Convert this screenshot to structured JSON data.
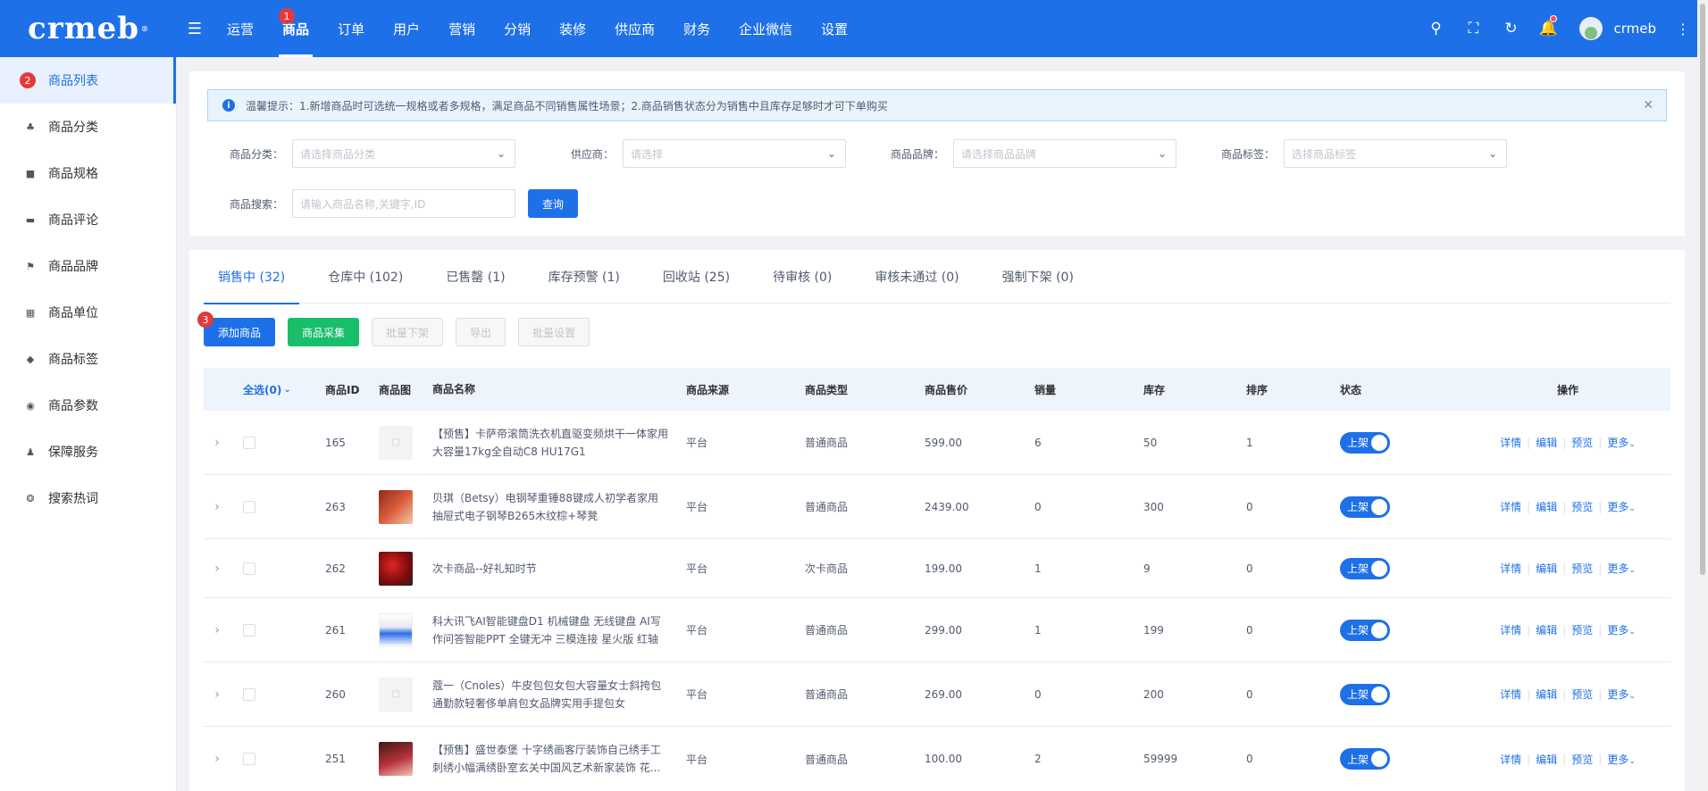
{
  "header": {
    "logo_text": "crmeb",
    "logo_mark": "®",
    "nav": [
      {
        "label": "运营"
      },
      {
        "label": "商品",
        "active": true,
        "badge": "1"
      },
      {
        "label": "订单"
      },
      {
        "label": "用户"
      },
      {
        "label": "营销"
      },
      {
        "label": "分销"
      },
      {
        "label": "装修"
      },
      {
        "label": "供应商"
      },
      {
        "label": "财务"
      },
      {
        "label": "企业微信"
      },
      {
        "label": "设置"
      }
    ],
    "username": "crmeb"
  },
  "sidebar": {
    "items": [
      {
        "label": "商品列表",
        "icon": "list-icon",
        "active": true,
        "badge": "2"
      },
      {
        "label": "商品分类",
        "icon": "category-icon"
      },
      {
        "label": "商品规格",
        "icon": "cube-icon"
      },
      {
        "label": "商品评论",
        "icon": "comment-icon"
      },
      {
        "label": "商品品牌",
        "icon": "brand-icon"
      },
      {
        "label": "商品单位",
        "icon": "unit-icon"
      },
      {
        "label": "商品标签",
        "icon": "tag-icon"
      },
      {
        "label": "商品参数",
        "icon": "eye-icon"
      },
      {
        "label": "保障服务",
        "icon": "service-icon"
      },
      {
        "label": "搜索热词",
        "icon": "hotword-icon"
      }
    ]
  },
  "notice": {
    "text": "温馨提示：1.新增商品时可选统一规格或者多规格，满足商品不同销售属性场景；2.商品销售状态分为销售中且库存足够时才可下单购买"
  },
  "filters": {
    "category": {
      "label": "商品分类：",
      "placeholder": "请选择商品分类"
    },
    "supplier": {
      "label": "供应商：",
      "placeholder": "请选择"
    },
    "brand": {
      "label": "商品品牌：",
      "placeholder": "请选择商品品牌"
    },
    "tag": {
      "label": "商品标签：",
      "placeholder": "选择商品标签"
    },
    "search": {
      "label": "商品搜索：",
      "placeholder": "请输入商品名称,关键字,ID"
    },
    "query_label": "查询"
  },
  "tabs": [
    {
      "label": "销售中 (32)",
      "active": true
    },
    {
      "label": "仓库中 (102)"
    },
    {
      "label": "已售罄 (1)"
    },
    {
      "label": "库存预警 (1)"
    },
    {
      "label": "回收站 (25)"
    },
    {
      "label": "待审核 (0)"
    },
    {
      "label": "审核未通过 (0)"
    },
    {
      "label": "强制下架 (0)"
    }
  ],
  "actions": {
    "add": "添加商品",
    "add_badge": "3",
    "collect": "商品采集",
    "batch_off": "批量下架",
    "export": "导出",
    "batch_set": "批量设置"
  },
  "table": {
    "headers": {
      "select_all": "全选(0)",
      "id": "商品ID",
      "image": "商品图",
      "name": "商品名称",
      "source": "商品来源",
      "type": "商品类型",
      "price": "商品售价",
      "sales": "销量",
      "stock": "库存",
      "sort": "排序",
      "status": "状态",
      "ops": "操作"
    },
    "rows": [
      {
        "id": "165",
        "thumb": "placeholder",
        "name": "【预售】卡萨帝滚筒洗衣机直驱变频烘干一体家用大容量17kg全自动C8 HU17G1",
        "source": "平台",
        "type": "普通商品",
        "price": "599.00",
        "sales": "6",
        "stock": "50",
        "sort": "1",
        "status": "上架"
      },
      {
        "id": "263",
        "thumb": "pic1",
        "name": "贝琪（Betsy）电钢琴重锤88键成人初学者家用抽屉式电子钢琴B265木纹棕+琴凳",
        "source": "平台",
        "type": "普通商品",
        "price": "2439.00",
        "sales": "0",
        "stock": "300",
        "sort": "0",
        "status": "上架"
      },
      {
        "id": "262",
        "thumb": "pic2",
        "name": "次卡商品--好礼知时节",
        "source": "平台",
        "type": "次卡商品",
        "price": "199.00",
        "sales": "1",
        "stock": "9",
        "sort": "0",
        "status": "上架"
      },
      {
        "id": "261",
        "thumb": "pic3",
        "name": "科大讯飞AI智能键盘D1 机械键盘 无线键盘 AI写作问答智能PPT 全键无冲 三模连接 星火版 红轴",
        "source": "平台",
        "type": "普通商品",
        "price": "299.00",
        "sales": "1",
        "stock": "199",
        "sort": "0",
        "status": "上架"
      },
      {
        "id": "260",
        "thumb": "placeholder",
        "name": "蔻一（Cnoles）牛皮包包女包大容量女士斜挎包通勤款轻奢侈单肩包女品牌实用手提包女",
        "source": "平台",
        "type": "普通商品",
        "price": "269.00",
        "sales": "0",
        "stock": "200",
        "sort": "0",
        "status": "上架"
      },
      {
        "id": "251",
        "thumb": "pic4",
        "name": "【预售】盛世泰堡 十字绣画客厅装饰自己绣手工刺绣小幅满绣卧室玄关中国风艺术新家装饰 花...",
        "source": "平台",
        "type": "普通商品",
        "price": "100.00",
        "sales": "2",
        "stock": "59999",
        "sort": "0",
        "status": "上架"
      }
    ],
    "ops": {
      "detail": "详情",
      "edit": "编辑",
      "preview": "预览",
      "more": "更多"
    }
  },
  "colors": {
    "primary": "#1e70e8",
    "success": "#19be6b",
    "badge": "#e4393c"
  }
}
